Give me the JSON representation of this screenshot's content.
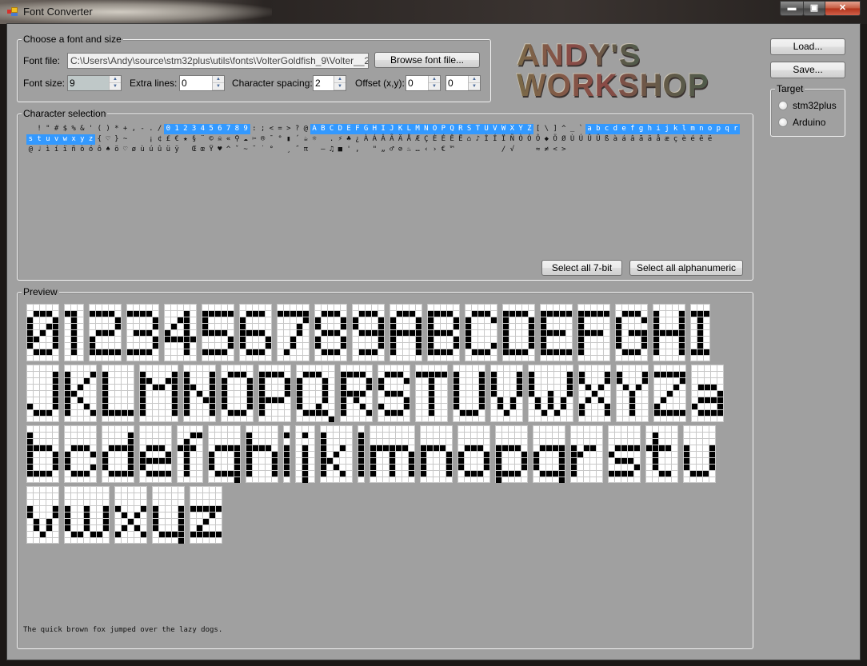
{
  "window": {
    "title": "Font Converter",
    "controls": {
      "minimize": "minimize-icon",
      "maximize": "maximize-icon",
      "close": "close-icon"
    }
  },
  "font_group": {
    "label": "Choose a font and size",
    "font_file_label": "Font file:",
    "font_file_value": "C:\\Users\\Andy\\source\\stm32plus\\utils\\fonts\\VolterGoldfish_9\\Volter__28Goldfish_29.ttf",
    "browse_label": "Browse font file...",
    "font_size_label": "Font size:",
    "font_size_value": "9",
    "extra_lines_label": "Extra lines:",
    "extra_lines_value": "0",
    "char_spacing_label": "Character spacing:",
    "char_spacing_value": "2",
    "offset_label": "Offset (x,y):",
    "offset_x_value": "0",
    "offset_y_value": "0"
  },
  "logo": {
    "line1": "ANDY'S",
    "line2": "WORKSHOP"
  },
  "side": {
    "load_label": "Load...",
    "save_label": "Save...",
    "target_label": "Target",
    "targets": [
      {
        "label": "stm32plus",
        "checked": false
      },
      {
        "label": "Arduino",
        "checked": false
      }
    ]
  },
  "char_selection": {
    "label": "Character selection",
    "selected": "0123456789ABCDEFGHIJKLMNOPQRSTUVWXYZabcdefghijklmnopqrstuvwxyz",
    "highlight_color": "#3399ff",
    "rows": [
      [
        " ",
        "!",
        "\"",
        "#",
        "$",
        "%",
        "&",
        "'",
        "(",
        ")",
        "*",
        "+",
        ",",
        "-",
        ".",
        "/",
        "0",
        "1",
        "2",
        "3",
        "4",
        "5",
        "6",
        "7",
        "8",
        "9",
        ":",
        ";",
        "<",
        "=",
        ">",
        "?",
        "@",
        "A",
        "B",
        "C",
        "D",
        "E",
        "F",
        "G",
        "H",
        "I",
        "J",
        "K",
        "L",
        "M",
        "N",
        "O",
        "P",
        "Q",
        "R",
        "S",
        "T",
        "U",
        "V",
        "W",
        "X",
        "Y",
        "Z",
        "[",
        "\\",
        "]",
        "^",
        "_",
        "`",
        "a",
        "b",
        "c",
        "d",
        "e",
        "f",
        "g",
        "h",
        "i",
        "j",
        "k",
        "l",
        "m",
        "n",
        "o",
        "p",
        "q",
        "r"
      ],
      [
        "s",
        "t",
        "u",
        "v",
        "w",
        "x",
        "y",
        "z",
        "{",
        "♡",
        "}",
        "~",
        " ",
        " ",
        "¡",
        "¢",
        "£",
        "€",
        "★",
        "§",
        "¨",
        "©",
        "☠",
        "«",
        "⚲",
        "☁",
        "✂",
        "®",
        "¯",
        "°",
        "▮",
        "´",
        "☕",
        "☼",
        " ",
        ".",
        "⚡",
        "♣",
        "¿",
        "À",
        "Á",
        "Â",
        "Ã",
        "Ä",
        "Å",
        "Æ",
        "Ç",
        "È",
        "É",
        "Ê",
        "Ë",
        "⌂",
        "♪",
        "Ì",
        "Í",
        "Ï",
        "Ñ",
        "Ò",
        "Ó",
        "Ô",
        "◆",
        "Ö",
        "Ø",
        "Ù",
        "Ú",
        "Û",
        "Ü",
        "ß",
        "à",
        "á",
        "â",
        "ã",
        "ä",
        "å",
        "æ",
        "ç",
        "è",
        "é",
        "ê",
        "ë"
      ],
      [
        "@",
        "♩",
        "ì",
        "í",
        "ï",
        "ñ",
        "ò",
        "ó",
        "ô",
        "♠",
        "ö",
        "♡",
        "ø",
        "ù",
        "ú",
        "û",
        "ü",
        "ÿ",
        " ",
        "Œ",
        "œ",
        "Ÿ",
        "♥",
        "^",
        "ˇ",
        "~",
        "˘",
        "˙",
        "°",
        " ",
        "¸",
        "˝",
        "π",
        " ",
        "–",
        "♫",
        "■",
        "'",
        ",",
        " ",
        "\"",
        "„",
        "♂",
        "⊘",
        "♨",
        "…",
        "‹",
        "›",
        "€",
        "™",
        " ",
        " ",
        " ",
        " ",
        " ",
        "/",
        "√",
        " ",
        " ",
        "≈",
        "≠",
        "<",
        ">"
      ]
    ],
    "select_7bit_label": "Select all 7-bit",
    "select_alnum_label": "Select all alphanumeric"
  },
  "preview": {
    "label": "Preview",
    "sample_text": "The quick brown fox jumped over the lazy dogs.",
    "glyphs": [
      {
        "char": "0",
        "rows": [
          ".###.",
          "#...#",
          "#..##",
          "#.#.#",
          "##..#",
          "#...#",
          ".###.",
          "....."
        ]
      },
      {
        "char": "1",
        "rows": [
          "##.",
          ".#.",
          ".#.",
          ".#.",
          ".#.",
          ".#.",
          ".#.",
          "..."
        ]
      },
      {
        "char": "2",
        "rows": [
          "####.",
          "....#",
          "....#",
          ".###.",
          "#....",
          "#....",
          "#####",
          "....."
        ]
      },
      {
        "char": "3",
        "rows": [
          "####.",
          "....#",
          "....#",
          ".###.",
          "....#",
          "....#",
          "####.",
          "....."
        ]
      },
      {
        "char": "4",
        "rows": [
          "...#.",
          "..##.",
          ".#.#.",
          "#..#.",
          "#####",
          "...#.",
          "...#.",
          "....."
        ]
      },
      {
        "char": "5",
        "rows": [
          "#####",
          "#....",
          "#....",
          "####.",
          "....#",
          "....#",
          "####.",
          "....."
        ]
      },
      {
        "char": "6",
        "rows": [
          ".###.",
          "#....",
          "#....",
          "####.",
          "#...#",
          "#...#",
          ".###.",
          "....."
        ]
      },
      {
        "char": "7",
        "rows": [
          "#####",
          "....#",
          "...#.",
          "...#.",
          "..#..",
          "..#..",
          ".#...",
          "....."
        ]
      },
      {
        "char": "8",
        "rows": [
          ".###.",
          "#...#",
          "#...#",
          ".###.",
          "#...#",
          "#...#",
          ".###.",
          "....."
        ]
      },
      {
        "char": "9",
        "rows": [
          ".###.",
          "#...#",
          "#...#",
          ".####",
          "....#",
          "....#",
          ".###.",
          "....."
        ]
      },
      {
        "char": "A",
        "rows": [
          ".###.",
          "#...#",
          "#...#",
          "#####",
          "#...#",
          "#...#",
          "#...#",
          "....."
        ]
      },
      {
        "char": "B",
        "rows": [
          "####.",
          "#...#",
          "#...#",
          "####.",
          "#...#",
          "#...#",
          "####.",
          "....."
        ]
      },
      {
        "char": "C",
        "rows": [
          ".###.",
          "#...#",
          "#....",
          "#....",
          "#....",
          "#...#",
          ".###.",
          "....."
        ]
      },
      {
        "char": "D",
        "rows": [
          "####.",
          "#...#",
          "#...#",
          "#...#",
          "#...#",
          "#...#",
          "####.",
          "....."
        ]
      },
      {
        "char": "E",
        "rows": [
          "#####",
          "#....",
          "#....",
          "####.",
          "#....",
          "#....",
          "#####",
          "....."
        ]
      },
      {
        "char": "F",
        "rows": [
          "#####",
          "#....",
          "#....",
          "####.",
          "#....",
          "#....",
          "#....",
          "....."
        ]
      },
      {
        "char": "G",
        "rows": [
          ".###.",
          "#...#",
          "#....",
          "#.###",
          "#...#",
          "#...#",
          ".###.",
          "....."
        ]
      },
      {
        "char": "H",
        "rows": [
          "#...#",
          "#...#",
          "#...#",
          "#####",
          "#...#",
          "#...#",
          "#...#",
          "....."
        ]
      },
      {
        "char": "I",
        "rows": [
          "###",
          ".#.",
          ".#.",
          ".#.",
          ".#.",
          ".#.",
          "###",
          "..."
        ]
      },
      {
        "char": "J",
        "rows": [
          "....#",
          "....#",
          "....#",
          "....#",
          "....#",
          "#...#",
          ".###.",
          "....."
        ]
      },
      {
        "char": "K",
        "rows": [
          "#...#",
          "#..#.",
          "#.#..",
          "##...",
          "#.#..",
          "#..#.",
          "#...#",
          "....."
        ]
      },
      {
        "char": "L",
        "rows": [
          "#....",
          "#....",
          "#....",
          "#....",
          "#....",
          "#....",
          "#####",
          "....."
        ]
      },
      {
        "char": "M",
        "rows": [
          "#....#",
          "##..##",
          "#.##.#",
          "#....#",
          "#....#",
          "#....#",
          "#....#",
          "......"
        ]
      },
      {
        "char": "N",
        "rows": [
          "#...#",
          "#...#",
          "##..#",
          "#.#.#",
          "#..##",
          "#...#",
          "#...#",
          "....."
        ]
      },
      {
        "char": "O",
        "rows": [
          ".###.",
          "#...#",
          "#...#",
          "#...#",
          "#...#",
          "#...#",
          ".###.",
          "....."
        ]
      },
      {
        "char": "P",
        "rows": [
          "####.",
          "#...#",
          "#...#",
          "#...#",
          "####.",
          "#....",
          "#....",
          "....."
        ]
      },
      {
        "char": "Q",
        "rows": [
          ".###..",
          "#...#.",
          "#...#.",
          "#...#.",
          "#...#.",
          "#..#..",
          ".####.",
          ".....#"
        ]
      },
      {
        "char": "R",
        "rows": [
          "####.",
          "#...#",
          "#...#",
          "####.",
          "#.#..",
          "#..#.",
          "#...#",
          "....."
        ]
      },
      {
        "char": "S",
        "rows": [
          ".###.",
          "#...#",
          "#....",
          ".###.",
          "....#",
          "#...#",
          ".###.",
          "....."
        ]
      },
      {
        "char": "T",
        "rows": [
          "#####",
          "..#..",
          "..#..",
          "..#..",
          "..#..",
          "..#..",
          "..#..",
          "....."
        ]
      },
      {
        "char": "U",
        "rows": [
          "#...#",
          "#...#",
          "#...#",
          "#...#",
          "#...#",
          "#...#",
          ".###.",
          "....."
        ]
      },
      {
        "char": "V",
        "rows": [
          "#...#",
          "#...#",
          "#...#",
          "#...#",
          ".#.#.",
          ".#.#.",
          "..#..",
          "....."
        ]
      },
      {
        "char": "W",
        "rows": [
          "#.....#",
          "#.....#",
          "#.....#",
          "#..#..#",
          ".#.#.#.",
          ".#.#.#.",
          "..#.#..",
          "......."
        ]
      },
      {
        "char": "X",
        "rows": [
          "#...#",
          "#...#",
          ".#.#.",
          "..#..",
          ".#.#.",
          "#...#",
          "#...#",
          "....."
        ]
      },
      {
        "char": "Y",
        "rows": [
          "#...#",
          "#...#",
          ".#.#.",
          "..#..",
          "..#..",
          "..#..",
          "..#..",
          "....."
        ]
      },
      {
        "char": "Z",
        "rows": [
          "#####",
          "....#",
          "...#.",
          "..#..",
          ".#...",
          "#....",
          "#####",
          "....."
        ]
      },
      {
        "char": "a",
        "rows": [
          ".....",
          ".....",
          ".###.",
          "....#",
          ".####",
          "#...#",
          ".####",
          "....."
        ]
      },
      {
        "char": "b",
        "rows": [
          "#....",
          "#....",
          "####.",
          "#...#",
          "#...#",
          "#...#",
          "####.",
          "....."
        ]
      },
      {
        "char": "c",
        "rows": [
          ".....",
          ".....",
          ".###.",
          "#...#",
          "#....",
          "#...#",
          ".###.",
          "....."
        ]
      },
      {
        "char": "d",
        "rows": [
          "....#",
          "....#",
          ".####",
          "#...#",
          "#...#",
          "#...#",
          ".####",
          "....."
        ]
      },
      {
        "char": "e",
        "rows": [
          ".....",
          ".....",
          ".###.",
          "#...#",
          "#####",
          "#....",
          ".####",
          "....."
        ]
      },
      {
        "char": "f",
        "rows": [
          "..##",
          ".#..",
          "###.",
          ".#..",
          ".#..",
          ".#..",
          ".#..",
          "...."
        ]
      },
      {
        "char": "g",
        "rows": [
          ".....",
          ".....",
          ".####",
          "#...#",
          "#...#",
          "#...#",
          ".####",
          "....#"
        ]
      },
      {
        "char": "h",
        "rows": [
          "#....",
          "#....",
          "####.",
          "#...#",
          "#...#",
          "#...#",
          "#...#",
          "....."
        ]
      },
      {
        "char": "i",
        "rows": [
          "#",
          ".",
          "#",
          "#",
          "#",
          "#",
          "#",
          "."
        ]
      },
      {
        "char": "j",
        "rows": [
          ".#.",
          "...",
          ".#.",
          ".#.",
          ".#.",
          ".#.",
          ".#.",
          ".#."
        ]
      },
      {
        "char": "k",
        "rows": [
          "#....",
          "#....",
          "#..#.",
          "#.#..",
          "##...",
          "#.#..",
          "#..#.",
          "....."
        ]
      },
      {
        "char": "l",
        "rows": [
          "#",
          "#",
          "#",
          "#",
          "#",
          "#",
          "#",
          "."
        ]
      },
      {
        "char": "m",
        "rows": [
          ".......",
          ".......",
          "######.",
          "#..#..#",
          "#..#..#",
          "#..#..#",
          "#..#..#",
          "......."
        ]
      },
      {
        "char": "n",
        "rows": [
          ".....",
          ".....",
          "####.",
          "#...#",
          "#...#",
          "#...#",
          "#...#",
          "....."
        ]
      },
      {
        "char": "o",
        "rows": [
          ".....",
          ".....",
          ".###.",
          "#...#",
          "#...#",
          "#...#",
          ".###.",
          "....."
        ]
      },
      {
        "char": "p",
        "rows": [
          ".....",
          ".....",
          "####.",
          "#...#",
          "#...#",
          "#...#",
          "####.",
          "#...."
        ]
      },
      {
        "char": "q",
        "rows": [
          ".....",
          ".....",
          ".####",
          "#...#",
          "#...#",
          "#...#",
          ".####",
          "....#"
        ]
      },
      {
        "char": "r",
        "rows": [
          ".....",
          ".....",
          "#.##.",
          "##...",
          "#....",
          "#....",
          "#....",
          "....."
        ]
      },
      {
        "char": "s",
        "rows": [
          ".....",
          ".....",
          ".####",
          "#....",
          ".###.",
          "....#",
          "####.",
          "....."
        ]
      },
      {
        "char": "t",
        "rows": [
          ".#...",
          ".#...",
          "####.",
          ".#...",
          ".#...",
          ".#...",
          "..##.",
          "....."
        ]
      },
      {
        "char": "u",
        "rows": [
          ".....",
          ".....",
          "#...#",
          "#...#",
          "#...#",
          "#...#",
          ".###.",
          "....."
        ]
      },
      {
        "char": "v",
        "rows": [
          ".....",
          ".....",
          "#...#",
          "#...#",
          ".#.#.",
          ".#.#.",
          "..#..",
          "....."
        ]
      },
      {
        "char": "w",
        "rows": [
          ".......",
          ".......",
          "#..#..#",
          "#..#..#",
          "#..#..#",
          "#..#..#",
          ".##.##.",
          "......."
        ]
      },
      {
        "char": "x",
        "rows": [
          ".....",
          ".....",
          "#...#",
          ".#.#.",
          "..#..",
          ".#.#.",
          "#...#",
          "....."
        ]
      },
      {
        "char": "y",
        "rows": [
          ".....",
          ".....",
          "#...#",
          "#...#",
          "#...#",
          "#...#",
          ".####",
          "....#"
        ]
      },
      {
        "char": "z",
        "rows": [
          ".....",
          ".....",
          "#####",
          "...#.",
          "..#..",
          ".#...",
          "#####",
          "....."
        ]
      }
    ]
  }
}
